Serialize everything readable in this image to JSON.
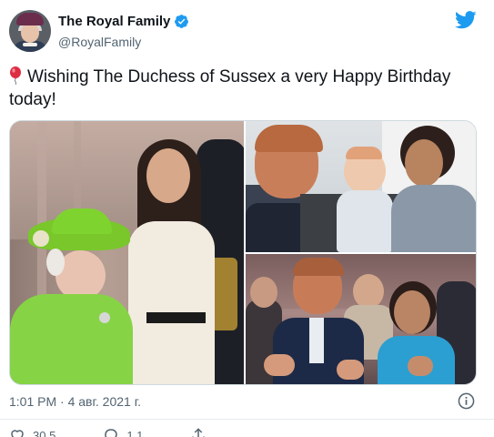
{
  "account": {
    "display_name": "The Royal Family",
    "handle": "@RoyalFamily",
    "verified_icon": "verified-badge-icon"
  },
  "tweet": {
    "emoji": "balloon",
    "text": "Wishing The Duchess of Sussex a very Happy Birthday today!"
  },
  "media": {
    "count": 3
  },
  "meta": {
    "timestamp": "1:01 PM · 4 авг. 2021 г."
  },
  "actions": {
    "likes": "30,5",
    "replies": "1,1"
  },
  "colors": {
    "brand": "#1d9bf0",
    "text": "#0f1419",
    "secondary": "#536471"
  }
}
